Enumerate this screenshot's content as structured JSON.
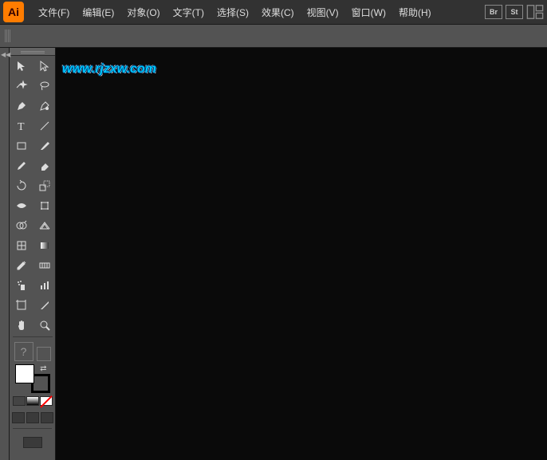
{
  "app": {
    "logo": "Ai"
  },
  "menu": {
    "file": "文件(F)",
    "edit": "编辑(E)",
    "object": "对象(O)",
    "type": "文字(T)",
    "select": "选择(S)",
    "effect": "效果(C)",
    "view": "视图(V)",
    "window": "窗口(W)",
    "help": "帮助(H)"
  },
  "top_icons": {
    "br": "Br",
    "st": "St"
  },
  "watermark": "www.rjzxw.com",
  "tools": {
    "selection": "选择",
    "direct_selection": "直接选择",
    "magic_wand": "魔棒",
    "lasso": "套索",
    "pen": "钢笔",
    "curvature": "曲率",
    "type": "文字",
    "line": "直线段",
    "rectangle": "矩形",
    "paintbrush": "画笔",
    "pencil": "铅笔",
    "eraser": "橡皮擦",
    "rotate": "旋转",
    "scale": "缩放",
    "width": "宽度",
    "free_transform": "自由变换",
    "shape_builder": "形状生成器",
    "perspective": "透视网格",
    "mesh": "网格",
    "gradient": "渐变",
    "eyedropper": "吸管",
    "blend": "混合",
    "symbol_sprayer": "符号喷枪",
    "column_graph": "柱形图",
    "artboard": "画板",
    "slice": "切片",
    "hand": "抓手",
    "zoom": "缩放"
  },
  "color": {
    "question": "?"
  }
}
